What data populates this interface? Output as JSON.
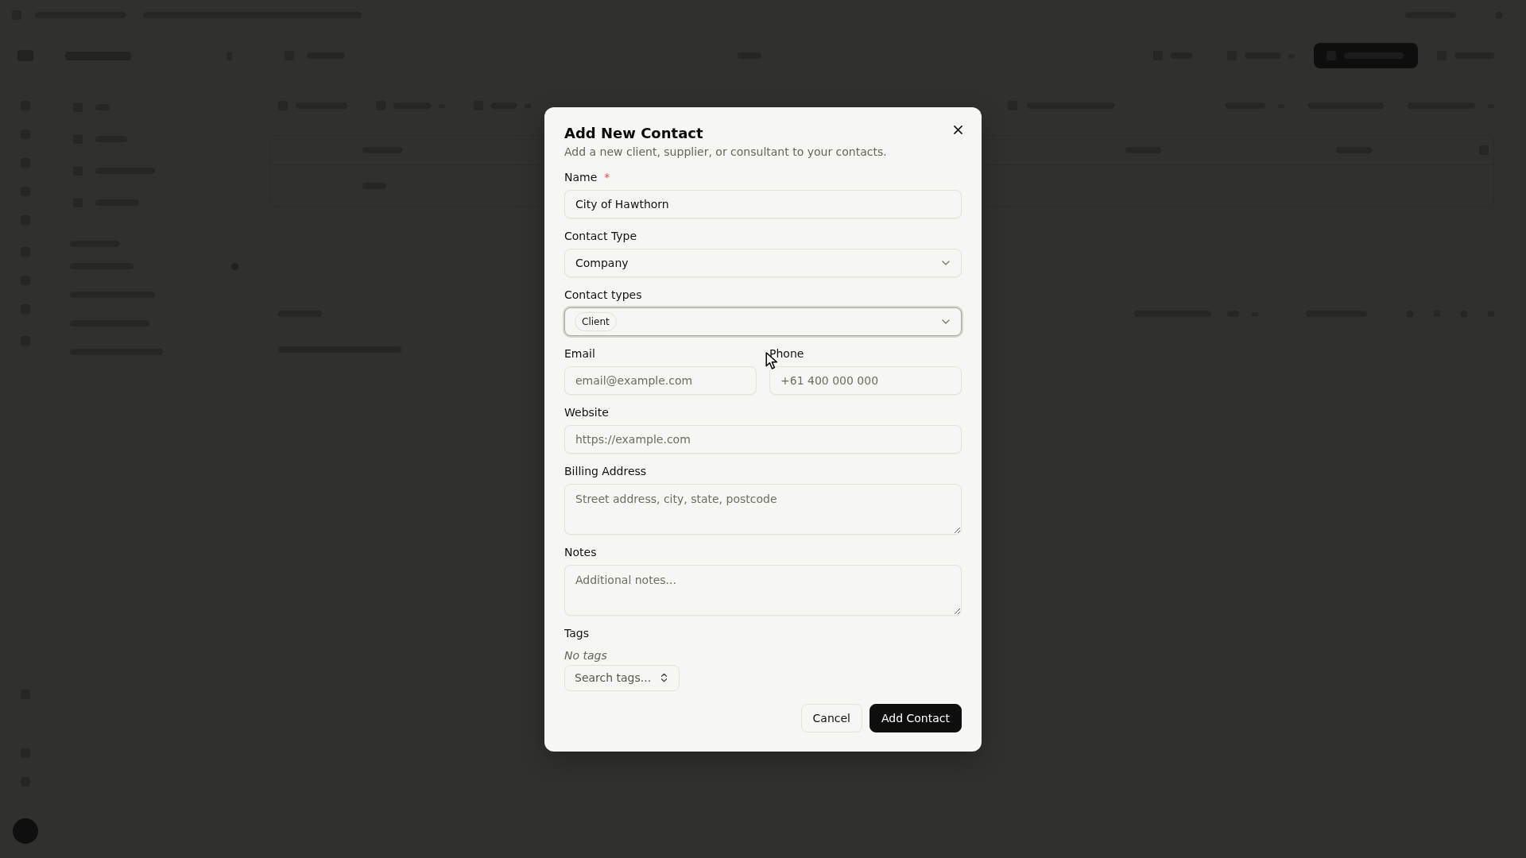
{
  "dialog": {
    "title": "Add New Contact",
    "description": "Add a new client, supplier, or consultant to your contacts.",
    "fields": [
      {
        "kind": "text",
        "label": "Name",
        "required_mark": "*",
        "value": "City of Hawthorn"
      },
      {
        "kind": "select",
        "label": "Contact Type",
        "value": "Company"
      },
      {
        "kind": "multiselect",
        "label": "Contact types",
        "focused": true,
        "chips": [
          "Client"
        ]
      },
      {
        "kind": "pair",
        "fields": [
          {
            "kind": "text",
            "label": "Email",
            "placeholder": "email@example.com"
          },
          {
            "kind": "text",
            "label": "Phone",
            "placeholder": "+61 400 000 000"
          }
        ]
      },
      {
        "kind": "text",
        "label": "Website",
        "placeholder": "https://example.com"
      },
      {
        "kind": "textarea",
        "label": "Billing Address",
        "placeholder": "Street address, city, state, postcode"
      },
      {
        "kind": "textarea",
        "label": "Notes",
        "placeholder": "Additional notes..."
      },
      {
        "kind": "tags",
        "label": "Tags",
        "empty_text": "No tags",
        "search_label": "Search tags..."
      }
    ],
    "buttons": [
      {
        "kind": "secondary",
        "label": "Cancel"
      },
      {
        "kind": "primary",
        "label": "Add Contact"
      }
    ]
  }
}
